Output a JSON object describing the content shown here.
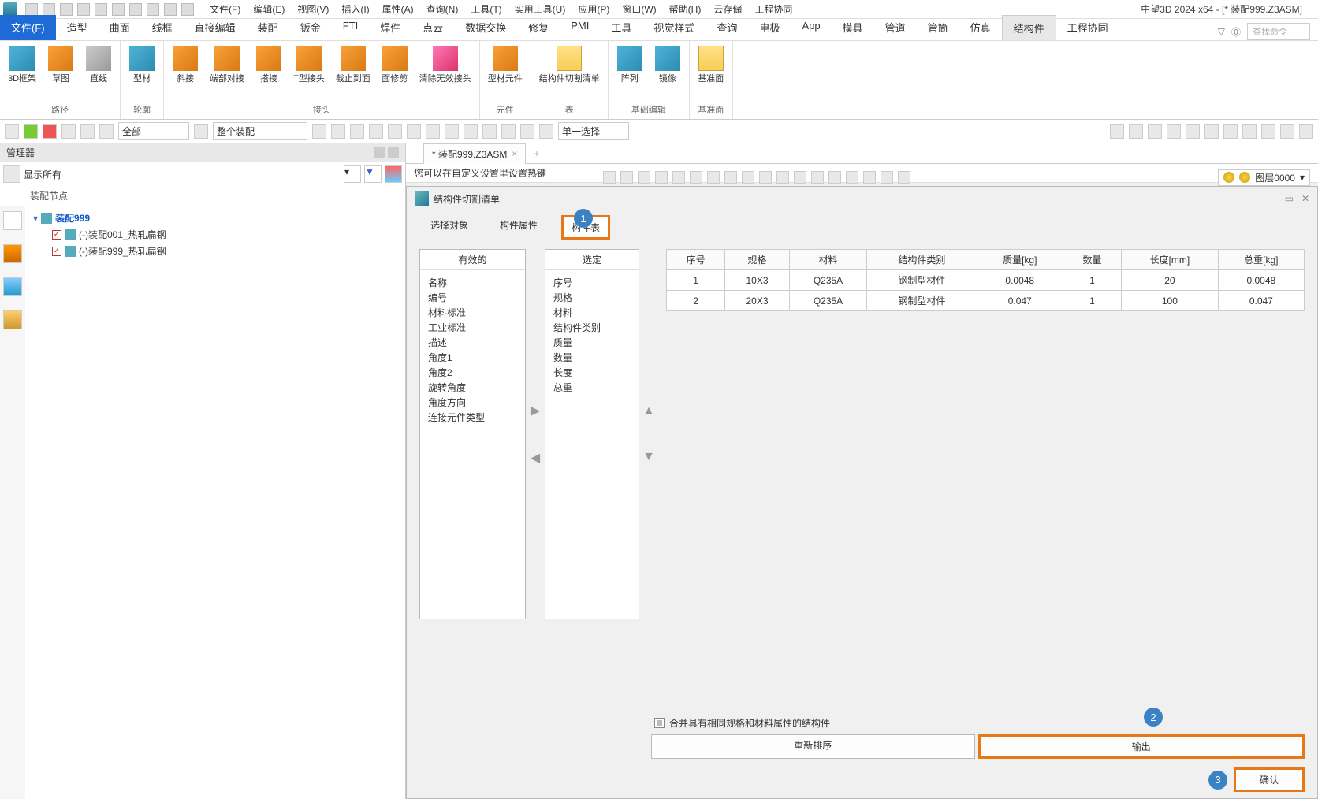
{
  "app": {
    "title": "中望3D 2024 x64 - [* 装配999.Z3ASM]"
  },
  "menus": [
    "文件(F)",
    "编辑(E)",
    "视图(V)",
    "插入(I)",
    "属性(A)",
    "查询(N)",
    "工具(T)",
    "实用工具(U)",
    "应用(P)",
    "窗口(W)",
    "帮助(H)",
    "云存储",
    "工程协同"
  ],
  "ribbon_tabs": [
    "文件(F)",
    "造型",
    "曲面",
    "线框",
    "直接编辑",
    "装配",
    "钣金",
    "FTI",
    "焊件",
    "点云",
    "数据交换",
    "修复",
    "PMI",
    "工具",
    "视觉样式",
    "查询",
    "电极",
    "App",
    "模具",
    "管道",
    "管筒",
    "仿真",
    "结构件",
    "工程协同"
  ],
  "ribbon_active_blue": 0,
  "ribbon_active_gray": 22,
  "search_placeholder": "查找命令",
  "ribbon_groups": [
    {
      "label": "路径",
      "items": [
        "3D框架",
        "草图",
        "直线"
      ]
    },
    {
      "label": "轮廓",
      "items": [
        "型材"
      ]
    },
    {
      "label": "接头",
      "items": [
        "斜接",
        "端部对接",
        "搭接",
        "T型接头",
        "截止到面",
        "面修剪",
        "清除无效接头"
      ]
    },
    {
      "label": "元件",
      "items": [
        "型材元件"
      ]
    },
    {
      "label": "表",
      "items": [
        "结构件切割清单"
      ]
    },
    {
      "label": "基础编辑",
      "items": [
        "阵列",
        "镜像"
      ]
    },
    {
      "label": "基准面",
      "items": [
        "基准面"
      ]
    }
  ],
  "toolbar2": {
    "combo1": "全部",
    "combo2": "整个装配",
    "combo3": "单一选择"
  },
  "manager": {
    "title": "管理器",
    "filter": "显示所有",
    "node_header": "装配节点",
    "root": "装配999",
    "children": [
      "(-)装配001_热轧扁钢",
      "(-)装配999_热轧扁钢"
    ]
  },
  "doc_tab": "* 装配999.Z3ASM",
  "hint": "您可以在自定义设置里设置热键",
  "layer": "图层0000",
  "dialog": {
    "title": "结构件切割清单",
    "tabs": [
      "选择对象",
      "构件属性",
      "构件表"
    ],
    "active_tab": 2,
    "effective_label": "有效的",
    "selected_label": "选定",
    "effective_list": [
      "名称",
      "编号",
      "材料标准",
      "工业标准",
      "描述",
      "角度1",
      "角度2",
      "旋转角度",
      "角度方向",
      "连接元件类型"
    ],
    "selected_list": [
      "序号",
      "规格",
      "材料",
      "结构件类别",
      "质量",
      "数量",
      "长度",
      "总重"
    ],
    "table_headers": [
      "序号",
      "规格",
      "材料",
      "结构件类别",
      "质量[kg]",
      "数量",
      "长度[mm]",
      "总重[kg]"
    ],
    "table_rows": [
      [
        "1",
        "10X3",
        "Q235A",
        "钢制型材件",
        "0.0048",
        "1",
        "20",
        "0.0048"
      ],
      [
        "2",
        "20X3",
        "Q235A",
        "钢制型材件",
        "0.047",
        "1",
        "100",
        "0.047"
      ]
    ],
    "merge_label": "合并具有相同规格和材料属性的结构件",
    "reorder_btn": "重新排序",
    "export_btn": "输出",
    "ok_btn": "确认"
  },
  "badges": {
    "b1": "1",
    "b2": "2",
    "b3": "3"
  }
}
